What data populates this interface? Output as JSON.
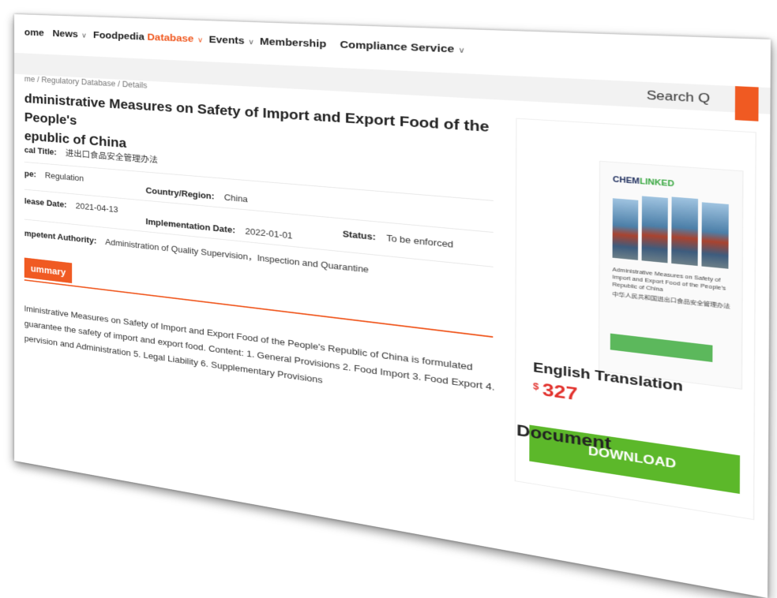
{
  "nav": {
    "items": [
      {
        "label": "ome",
        "caret": ""
      },
      {
        "label": "News",
        "caret": "∨"
      },
      {
        "label": "Foodpedia",
        "caret": ""
      },
      {
        "label": "Database",
        "caret": "∨"
      },
      {
        "label": "Events",
        "caret": "∨"
      },
      {
        "label": "Membership",
        "caret": ""
      },
      {
        "label": "Compliance Service",
        "caret": "∨"
      }
    ],
    "active_color": "#f05a22"
  },
  "search": {
    "label": "Search Q"
  },
  "breadcrumb": "me  /  Regulatory Database  /  Details",
  "title": {
    "line1": "dministrative Measures on Safety of Import and Export Food of the People's",
    "line2": "epublic of China"
  },
  "meta": {
    "original_title_label": "cal Title:",
    "original_title_value": "进出口食品安全管理办法",
    "type_label": "pe:",
    "type_value": "Regulation",
    "country_label": "Country/Region:",
    "country_value": "China",
    "release_label": "lease Date:",
    "release_value": "2021-04-13",
    "implementation_label": "Implementation Date:",
    "implementation_value": "2022-01-01",
    "status_label": "Status:",
    "status_value": "To be enforced",
    "authority_label": "mpetent Authority:",
    "authority_value": "Administration of Quality Supervision，Inspection and Quarantine"
  },
  "summary": {
    "tab_label": "ummary",
    "lines": [
      "lministrative Measures on Safety of Import and Export Food of the People's Republic of China is formulated",
      "guarantee the safety of import and export food. Content: 1. General Provisions 2. Food Import 3. Food Export 4.",
      "pervision and Administration 5. Legal Liability 6. Supplementary Provisions"
    ]
  },
  "sidebar": {
    "cover": {
      "logo_a": "CHEM",
      "logo_b": "LINKED",
      "text_en": "Administrative Measures on Safety of Import and Export Food of the People's Republic of China",
      "text_cn": "中华人民共和国进出口食品安全管理办法"
    },
    "heading": "English Translation",
    "currency": "$",
    "price": "327",
    "download_label": "DOWNLOAD"
  },
  "document_heading": "Document",
  "colors": {
    "accent": "#f05a22",
    "price": "#e2322d",
    "download": "#5cb82a"
  }
}
